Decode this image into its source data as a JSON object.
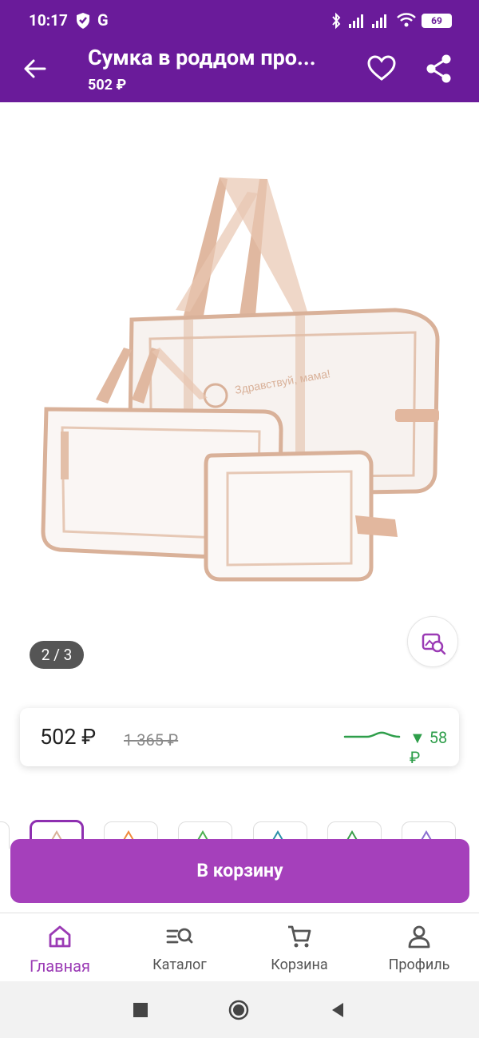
{
  "status_bar": {
    "time": "10:17",
    "g_label": "G",
    "battery": "69"
  },
  "header": {
    "title": "Сумка в роддом про...",
    "subtitle": "502 ₽"
  },
  "gallery": {
    "counter": "2 / 3",
    "watermark": "Здравствуй, мама!"
  },
  "price_card": {
    "price": "502 ₽",
    "old_price": "1 365 ₽",
    "drop": "▼ 58 ₽"
  },
  "cart_button": {
    "label": "В корзину"
  },
  "bottom_nav": [
    {
      "label": "Главная",
      "icon": "home-icon"
    },
    {
      "label": "Каталог",
      "icon": "catalog-search-icon"
    },
    {
      "label": "Корзина",
      "icon": "cart-icon"
    },
    {
      "label": "Профиль",
      "icon": "profile-icon"
    }
  ],
  "colors": {
    "brand": "#6a1b9a",
    "button": "#a540bb",
    "active": "#9b3bb5",
    "price_drop": "#2e9e4a"
  }
}
